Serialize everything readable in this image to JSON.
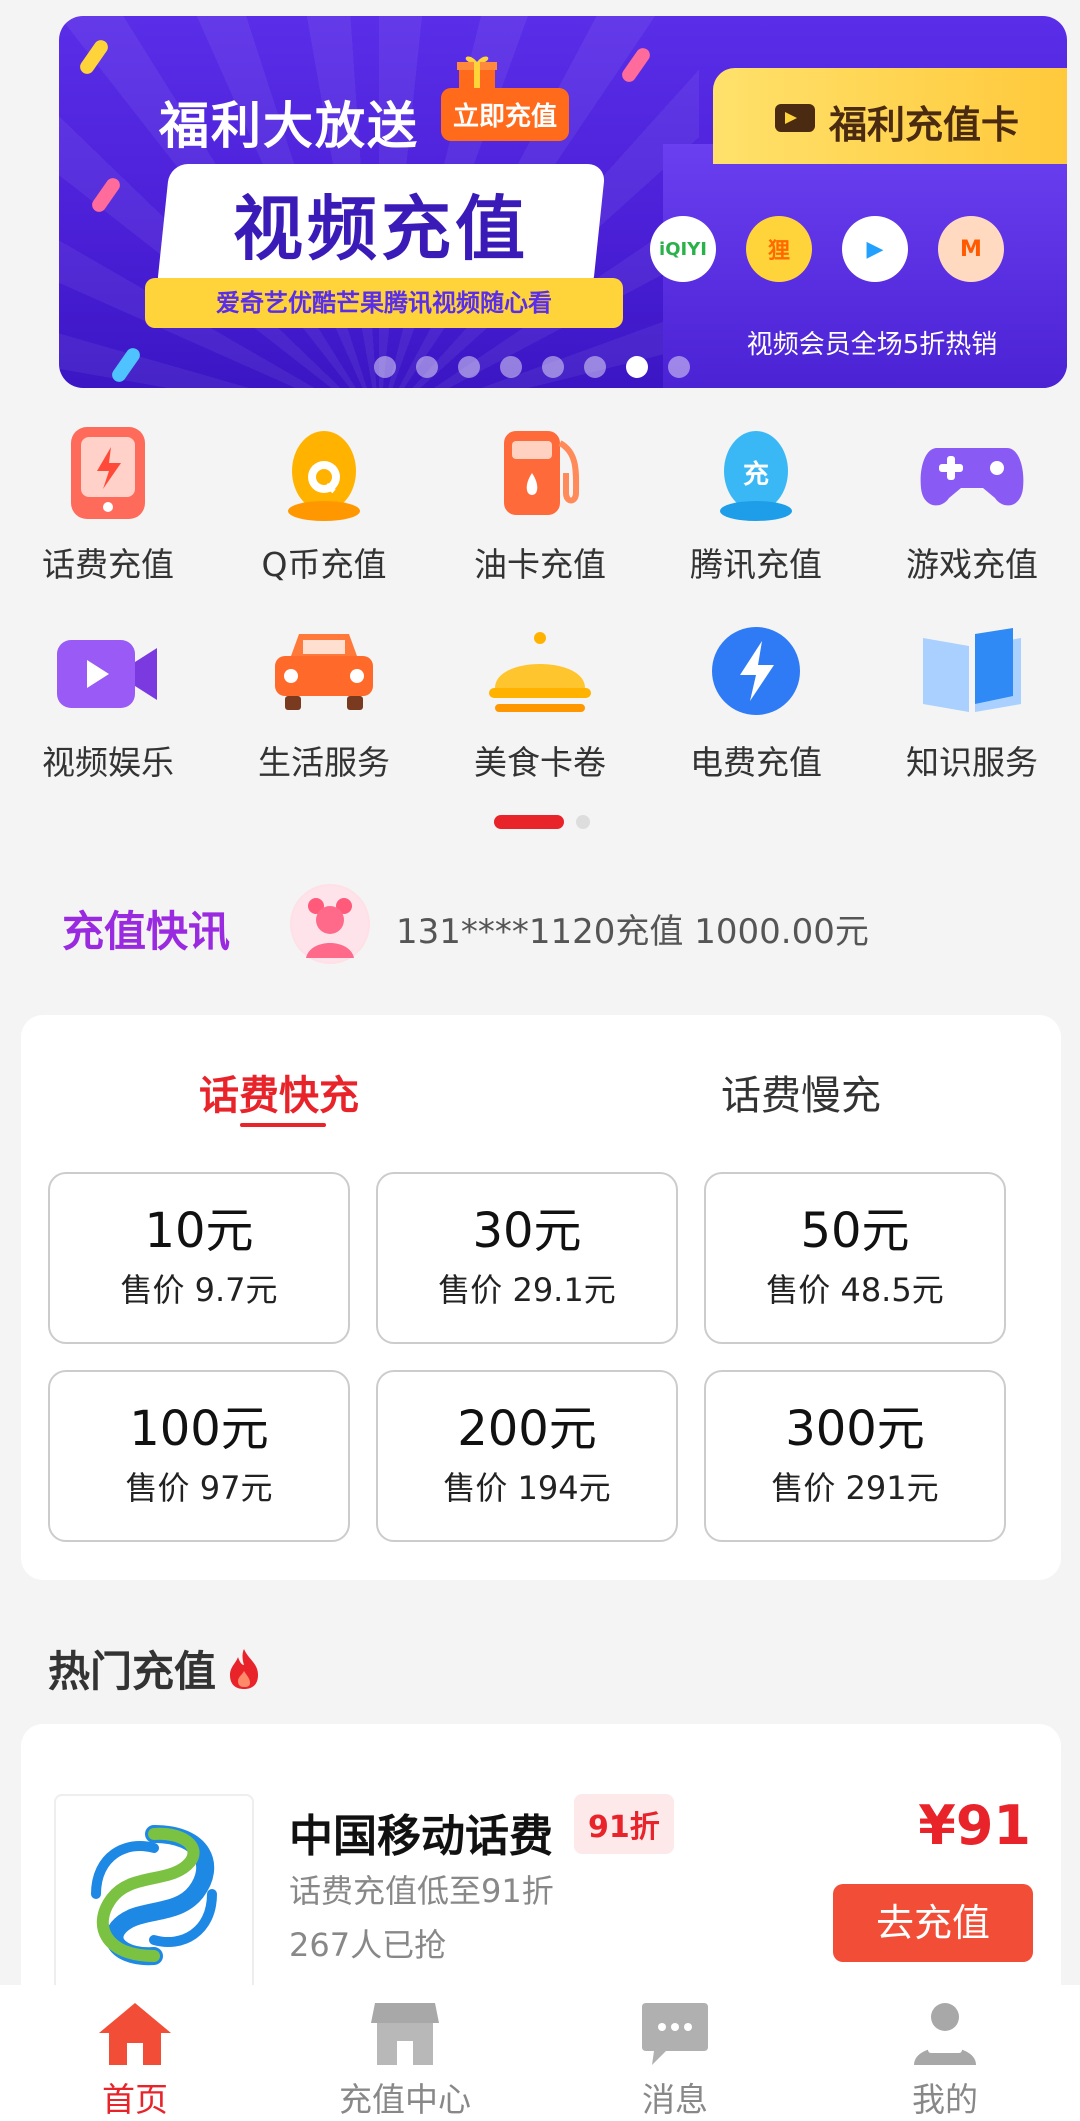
{
  "banner": {
    "title": "福利大放送",
    "badge": "立即充值",
    "main_text": "视频充值",
    "sub_text": "爱奇艺优酷芒果腾讯视频随心看",
    "card_title": "福利充值卡",
    "card_tagline": "视频会员全场5折热销",
    "logos": [
      {
        "name": "iqiyi-logo",
        "text": "iQIYI",
        "color": "#2bb14a"
      },
      {
        "name": "youku-logo",
        "text": "狸",
        "color": "#ff6a00"
      },
      {
        "name": "tencent-video-logo",
        "text": "▶",
        "color": "#21a0ff"
      },
      {
        "name": "mgtv-logo",
        "text": "M",
        "color": "#ff5a00"
      }
    ],
    "dot_count": 8,
    "active_dot": 6
  },
  "grid": [
    {
      "name": "phone-bill",
      "label": "话费充值",
      "icon": "phone-icon"
    },
    {
      "name": "qcoin",
      "label": "Q币充值",
      "icon": "penguin-q-icon"
    },
    {
      "name": "fuel-card",
      "label": "油卡充值",
      "icon": "fuel-pump-icon"
    },
    {
      "name": "tencent",
      "label": "腾讯充值",
      "icon": "penguin-charge-icon"
    },
    {
      "name": "game",
      "label": "游戏充值",
      "icon": "gamepad-icon"
    },
    {
      "name": "video",
      "label": "视频娱乐",
      "icon": "video-camera-icon"
    },
    {
      "name": "life",
      "label": "生活服务",
      "icon": "car-icon"
    },
    {
      "name": "food",
      "label": "美食卡卷",
      "icon": "food-cloche-icon"
    },
    {
      "name": "electricity",
      "label": "电费充值",
      "icon": "lightning-icon"
    },
    {
      "name": "knowledge",
      "label": "知识服务",
      "icon": "book-icon"
    }
  ],
  "news": {
    "title": "充值快讯",
    "text": "131****1120充值 1000.00元"
  },
  "recharge": {
    "tab_fast": "话费快充",
    "tab_slow": "话费慢充",
    "options": [
      {
        "face": "10元",
        "sale": "售价 9.7元"
      },
      {
        "face": "30元",
        "sale": "售价 29.1元"
      },
      {
        "face": "50元",
        "sale": "售价 48.5元"
      },
      {
        "face": "100元",
        "sale": "售价 97元"
      },
      {
        "face": "200元",
        "sale": "售价 194元"
      },
      {
        "face": "300元",
        "sale": "售价 291元"
      }
    ]
  },
  "hot": {
    "title": "热门充值",
    "item": {
      "name": "中国移动话费",
      "discount": "91折",
      "desc": "话费充值低至91折",
      "count": "267人已抢",
      "price": "¥91",
      "button": "去充值"
    }
  },
  "nav": [
    {
      "name": "home",
      "label": "首页",
      "icon": "home-icon",
      "active": true
    },
    {
      "name": "recharge-center",
      "label": "充值中心",
      "icon": "store-icon",
      "active": false
    },
    {
      "name": "messages",
      "label": "消息",
      "icon": "chat-icon",
      "active": false
    },
    {
      "name": "mine",
      "label": "我的",
      "icon": "user-icon",
      "active": false
    }
  ],
  "colors": {
    "accent": "#e8232a",
    "news_title": "#9a2ae0",
    "banner_bg": "#5a2ee8"
  }
}
